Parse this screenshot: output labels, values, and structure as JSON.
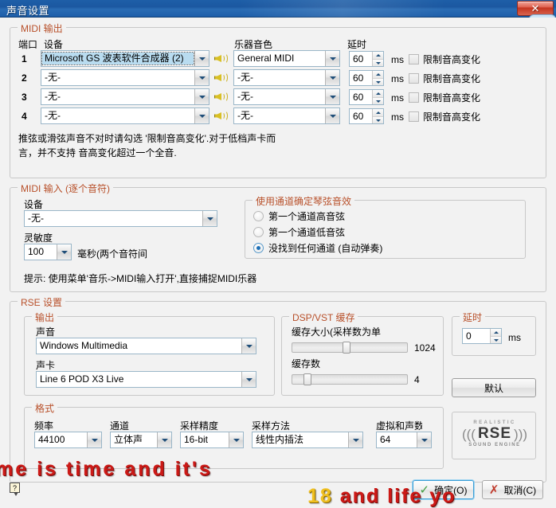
{
  "window": {
    "title": "声音设置",
    "close_label": "✕",
    "app_icon": "guitar-pro-icon"
  },
  "midi_output": {
    "legend": "MIDI 输出",
    "col_port": "端口",
    "col_device": "设备",
    "col_instrument": "乐器音色",
    "col_delay": "延时",
    "ms_unit": "ms",
    "rows": [
      {
        "port": "1",
        "device": "Microsoft GS 波表软件合成器 (2)",
        "instrument": "General MIDI",
        "delay": "60",
        "limit_label": "限制音高变化",
        "limit_checked": false,
        "selected": true
      },
      {
        "port": "2",
        "device": "-无-",
        "instrument": "-无-",
        "delay": "60",
        "limit_label": "限制音高变化",
        "limit_checked": false,
        "selected": false
      },
      {
        "port": "3",
        "device": "-无-",
        "instrument": "-无-",
        "delay": "60",
        "limit_label": "限制音高变化",
        "limit_checked": false,
        "selected": false
      },
      {
        "port": "4",
        "device": "-无-",
        "instrument": "-无-",
        "delay": "60",
        "limit_label": "限制音高变化",
        "limit_checked": false,
        "selected": false
      }
    ],
    "note_line1": "推弦或滑弦声音不对时请勾选 '限制音高变化'.对于低档声卡而",
    "note_line2": "言，并不支持 音高变化超过一个全音."
  },
  "midi_input": {
    "legend": "MIDI 输入 (逐个音符)",
    "device_label": "设备",
    "device_value": "-无-",
    "sensitivity_label": "灵敏度",
    "sensitivity_value": "100",
    "sensitivity_unit": "毫秒(两个音符间",
    "hint": "提示: 使用菜单'音乐->MIDI输入打开',直接捕捉MIDI乐器",
    "channel_group": {
      "legend": "使用通道确定琴弦音效",
      "options": [
        {
          "label": "第一个通道高音弦",
          "selected": false
        },
        {
          "label": "第一个通道低音弦",
          "selected": false
        },
        {
          "label": "没找到任何通道 (自动弹奏)",
          "selected": true
        }
      ]
    }
  },
  "rse": {
    "legend": "RSE 设置",
    "output": {
      "legend": "输出",
      "sound_label": "声音",
      "sound_value": "Windows Multimedia",
      "card_label": "声卡",
      "card_value": "Line 6 POD X3 Live"
    },
    "buffer": {
      "legend": "DSP/VST 缓存",
      "size_label": "缓存大小(采样数为单",
      "size_value": "1024",
      "size_pct": 47,
      "count_label": "缓存数",
      "count_value": "4",
      "count_pct": 11
    },
    "latency": {
      "legend": "延时",
      "value": "0",
      "unit": "ms"
    },
    "default_button": "默认",
    "format": {
      "legend": "格式",
      "freq_label": "频率",
      "freq_value": "44100",
      "channel_label": "通道",
      "channel_value": "立体声",
      "depth_label": "采样精度",
      "depth_value": "16-bit",
      "method_label": "采样方法",
      "method_value": "线性内插法",
      "voices_label": "虚拟和声数",
      "voices_value": "64"
    },
    "logo": {
      "top": "REALISTIC",
      "mid": "RSE",
      "sub": "SOUND ENGINE",
      "arc_left": "(((",
      "arc_right": ")))"
    }
  },
  "footer": {
    "help_glyph": "?",
    "ok_label": "确定(O)",
    "cancel_label": "取消(C)",
    "ok_icon": "check-icon",
    "cancel_icon": "x-icon"
  },
  "overlay": {
    "line1": "me is time and it's",
    "line2_highlight": "18",
    "line2_rest": " and  life yo"
  }
}
